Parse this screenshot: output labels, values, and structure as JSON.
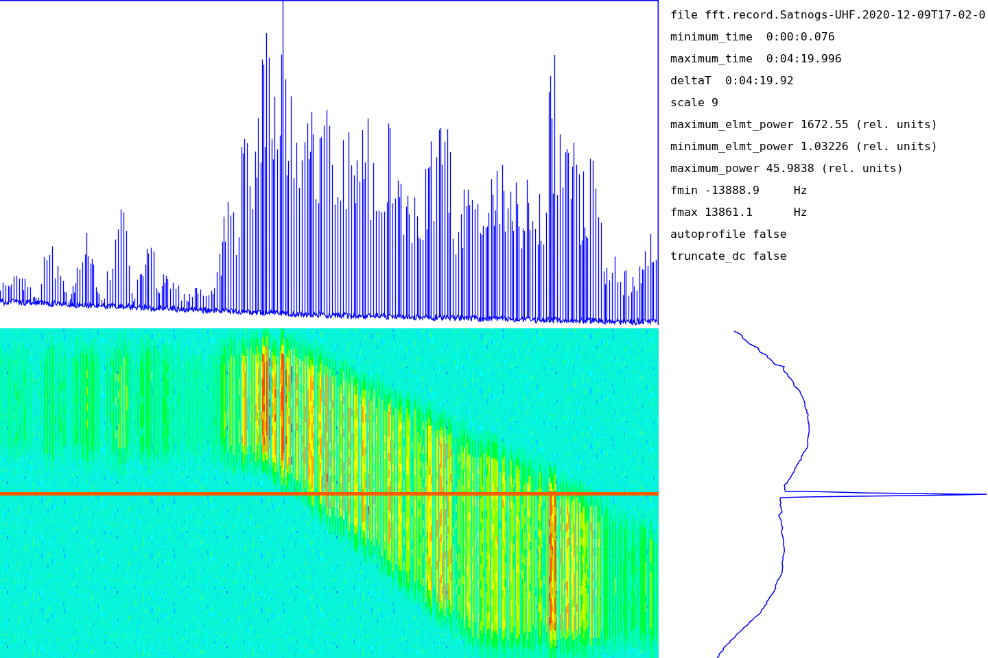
{
  "info": {
    "file_line": "file fft.record.Satnogs-UHF.2020-12-09T17-02-0",
    "parameters": [
      "minimum_time  0:00:0.076",
      "maximum_time  0:04:19.996",
      "deltaT  0:04:19.92",
      "scale 9",
      "maximum_elmt_power 1672.55 (rel. units)",
      "minimum_elmt_power 1.03226 (rel. units)",
      "maximum_power 45.9838 (rel. units)",
      "fmin -13888.9     Hz",
      "fmax 13861.1      Hz",
      "autoprofile false",
      "truncate_dc false"
    ]
  }
}
